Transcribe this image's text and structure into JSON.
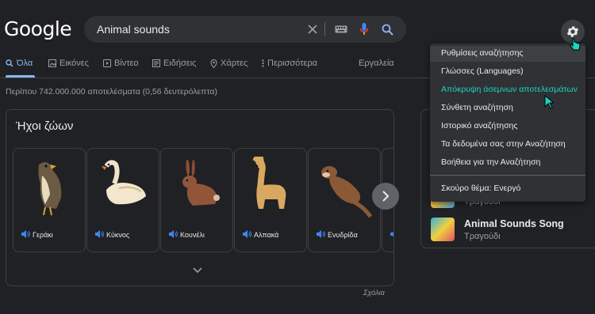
{
  "header": {
    "logo": "Google",
    "search_value": "Animal sounds"
  },
  "tabs": [
    {
      "label": "Όλα",
      "icon": "search-icon"
    },
    {
      "label": "Εικόνες",
      "icon": "image-icon"
    },
    {
      "label": "Βίντεο",
      "icon": "play-icon"
    },
    {
      "label": "Ειδήσεις",
      "icon": "news-icon"
    },
    {
      "label": "Χάρτες",
      "icon": "map-pin-icon"
    },
    {
      "label": "Περισσότερα",
      "icon": "more-dots-icon"
    }
  ],
  "tools_label": "Εργαλεία",
  "results_count": "Περίπου 742.000.000 αποτελέσματα (0,56 δευτερόλεπτα)",
  "card": {
    "title": "Ήχοι ζώων",
    "animals": [
      {
        "label": "Γεράκι"
      },
      {
        "label": "Κύκνος"
      },
      {
        "label": "Κουνέλι"
      },
      {
        "label": "Αλπακά"
      },
      {
        "label": "Ενυδρίδα"
      }
    ],
    "feedback": "Σχόλια"
  },
  "right_panel": {
    "song1_sub": "Τραγούδι",
    "song2_title": "Animal Sounds Song",
    "song2_sub": "Τραγούδι"
  },
  "menu": {
    "items": [
      "Ρυθμίσεις αναζήτησης",
      "Γλώσσες (Languages)",
      "Απόκρυψη άσεμνων αποτελεσμάτων",
      "Σύνθετη αναζήτηση",
      "Ιστορικό αναζήτησης",
      "Τα δεδομένα σας στην Αναζήτηση",
      "Βοήθεια για την Αναζήτηση",
      "Σκούρο θέμα: Ενεργό"
    ]
  },
  "colors": {
    "background": "#202124",
    "accent": "#8ab4f8",
    "teal_highlight": "#1ed5c0"
  }
}
